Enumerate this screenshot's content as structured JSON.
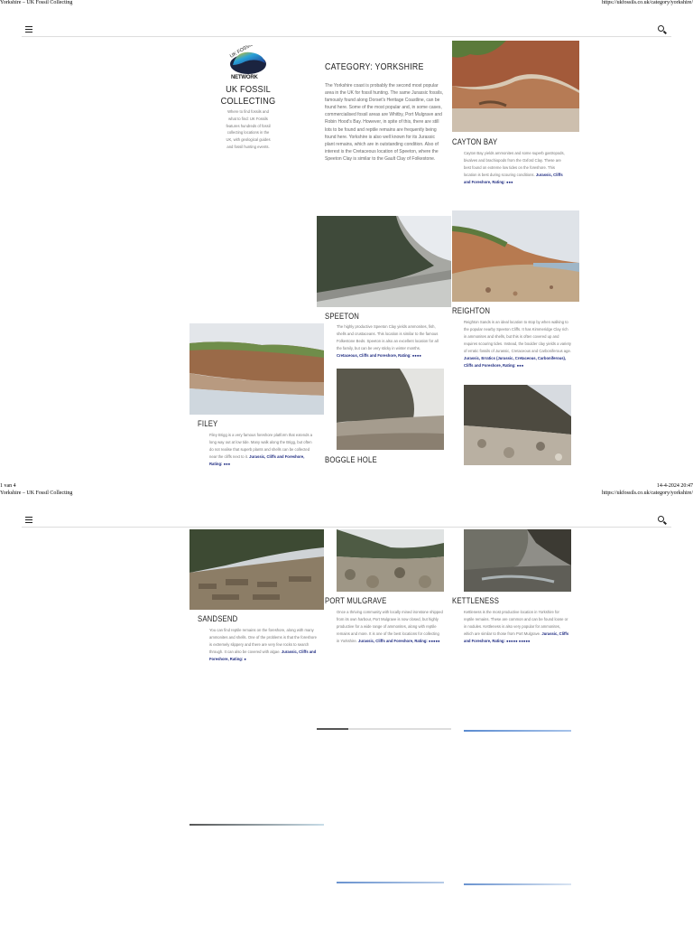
{
  "print_header": {
    "title": "Yorkshire – UK Fossil Collecting",
    "url": "https://ukfossils.co.uk/category/yorkshire/"
  },
  "print_footer": {
    "page": "1 van 4",
    "datetime": "14-4-2024 20:47"
  },
  "nav": {
    "menu_icon": "hamburger-menu-icon",
    "search_icon": "search-icon"
  },
  "site": {
    "logo_text": "UK FOSSILS NETWORK",
    "title": "UK FOSSIL COLLECTING",
    "description": "Where to find fossils and what to find: UK Fossils features hundreds of fossil collecting locations in the UK, with geological guides and fossil hunting events."
  },
  "category": {
    "title": "CATEGORY: YORKSHIRE",
    "description": "The Yorkshire coast is probably the second most popular area in the UK for fossil hunting. The same Jurassic fossils, famously found along Dorset's Heritage Coastline, can be found here. Some of the most popular and, in some cases, commercialised fossil areas are Whitby, Port Mulgrave and Robin Hood's Bay. However, in spite of this, there are still lots to be found and reptile remains are frequently being found here. Yorkshire is also well known for its Jurassic plant remains, which are in outstanding condition. Also of interest is the Cretaceous location of Speeton, where the Speeton Clay is similar to the Gault Clay of Folkestone."
  },
  "locations": [
    {
      "name": "CAYTON BAY",
      "text": "Cayton Bay yields ammonites and some superb gastropods, bivalves and brachiopods from the Oxford Clay. These are best found on extreme low tides on the foreshore. This location is best during scouring conditions.",
      "tags": "Jurassic, Cliffs and Foreshore, Rating: ●●●"
    },
    {
      "name": "SPEETON",
      "text": "The highly productive Speeton Clay yields ammonites, fish, shells and crustaceans. This location is similar to the famous Folkestone Beds. Speeton is also an excellent location for all the family, but can be very sticky in winter months.",
      "tags": "Cretaceous, Cliffs and Foreshore, Rating: ●●●●"
    },
    {
      "name": "REIGHTON",
      "text": "Reighton Sands is an ideal location to stop by when walking to the popular nearby Speeton Cliffs. It has Kimmeridge Clay rich in ammonites and shells, but this is often covered up and requires scouring tides. Instead, the boulder clay yields a variety of erratic fossils of Jurassic, Cretaceous and Carboniferous age.",
      "tags": "Jurassic, Erratics (Jurassic, Cretaceous, Carboniferous), Cliffs and Foreshore, Rating: ●●●"
    },
    {
      "name": "FILEY",
      "text": "Filey Brigg is a very famous foreshore platform that extends a long way out at low tide. Many walk along the Brigg, but often do not realise that superb plants and shells can be collected near the cliffs next to it.",
      "tags": "Jurassic, Cliffs and Foreshore, Rating: ●●●"
    },
    {
      "name": "BOGGLE HOLE",
      "text": "",
      "tags": ""
    },
    {
      "name": "SANDSEND",
      "text": "You can find reptile remains on the foreshore, along with many ammonites and shells. One of the problems is that the foreshore is extremely slippery and there are very few rocks to search through. It can also be covered with algae.",
      "tags": "Jurassic, Cliffs and Foreshore, Rating: ●"
    },
    {
      "name": "PORT MULGRAVE",
      "text": "Once a thriving community with locally mined ironstone shipped from its own harbour, Port Mulgrave is now closed, but highly productive for a wide range of ammonites, along with reptile remains and more. It is one of the best locations for collecting in Yorkshire.",
      "tags": "Jurassic, Cliffs and Foreshore, Rating: ●●●●●"
    },
    {
      "name": "KETTLENESS",
      "text": "Kettleness is the most productive location in Yorkshire for reptile remains. These are common and can be found loose or in nodules. Kettleness is also very popular for ammonites, which are similar to those from Port Mulgrave.",
      "tags": "Jurassic, Cliffs and Foreshore, Rating: ●●●●● ●●●●●"
    }
  ]
}
